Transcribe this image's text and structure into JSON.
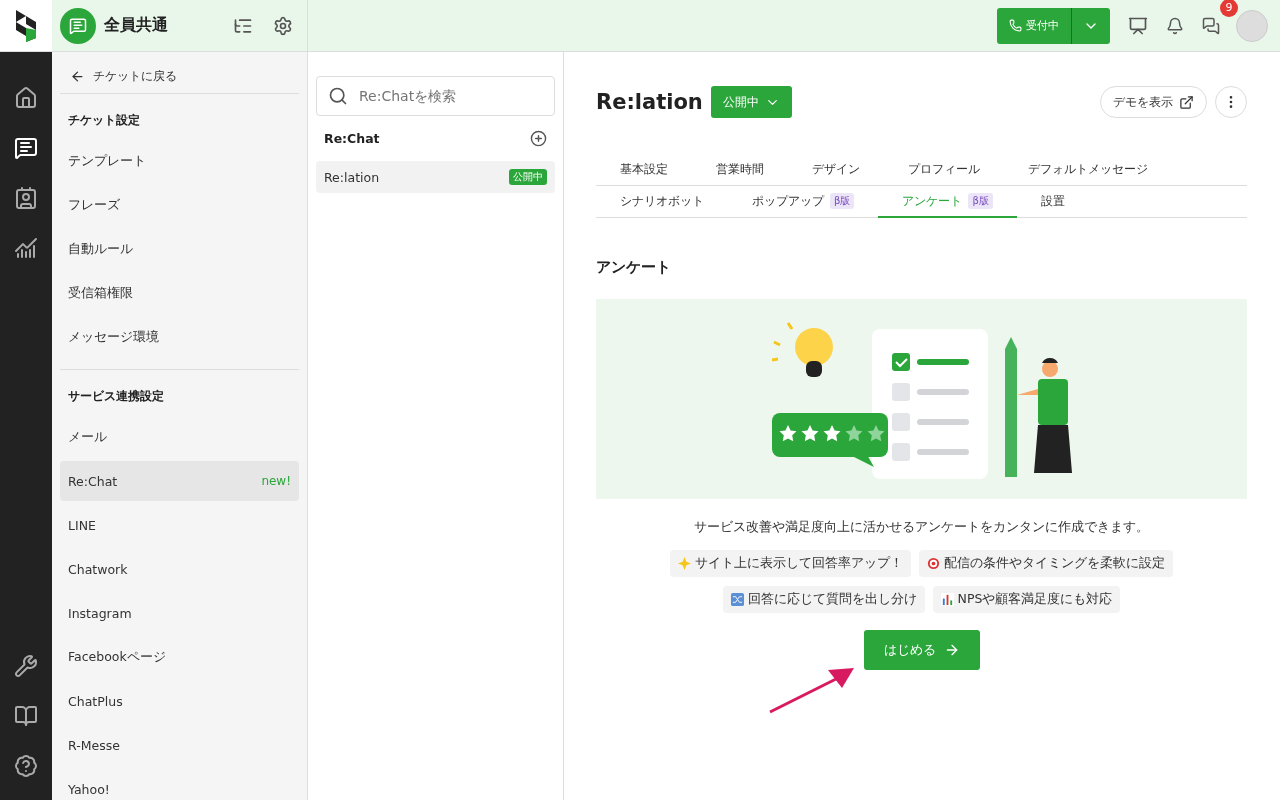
{
  "app_bar": {
    "workspace": "全員共通",
    "status_button": "受付中",
    "notification_count": "9"
  },
  "rail": [
    {
      "kind": "home",
      "selected": false
    },
    {
      "kind": "ticket",
      "selected": true
    },
    {
      "kind": "contacts",
      "selected": false
    },
    {
      "kind": "analytics",
      "selected": false
    }
  ],
  "rail_bottom": [
    {
      "kind": "tools",
      "selected": false
    },
    {
      "kind": "book",
      "selected": false
    },
    {
      "kind": "help",
      "selected": false
    }
  ],
  "sidebar": {
    "back_link": "チケットに戻る",
    "sections": [
      {
        "title": "チケット設定",
        "items": [
          {
            "label": "テンプレート",
            "selected": false
          },
          {
            "label": "フレーズ",
            "selected": false
          },
          {
            "label": "自動ルール",
            "selected": false
          },
          {
            "label": "受信箱権限",
            "selected": false
          },
          {
            "label": "メッセージ環境",
            "selected": false
          }
        ]
      },
      {
        "title": "サービス連携設定",
        "items": [
          {
            "label": "メール",
            "selected": false
          },
          {
            "label": "Re:Chat",
            "selected": true,
            "badge": "new!"
          },
          {
            "label": "LINE",
            "selected": false
          },
          {
            "label": "Chatwork",
            "selected": false
          },
          {
            "label": "Instagram",
            "selected": false
          },
          {
            "label": "Facebookページ",
            "selected": false
          },
          {
            "label": "ChatPlus",
            "selected": false
          },
          {
            "label": "R-Messe",
            "selected": false
          },
          {
            "label": "Yahoo!",
            "selected": false
          }
        ]
      }
    ]
  },
  "channel_list": {
    "search_placeholder": "Re:Chatを検索",
    "group_title": "Re:Chat",
    "items": [
      {
        "label": "Re:lation",
        "status": "公開中",
        "selected": true
      }
    ]
  },
  "main": {
    "title": "Re:lation",
    "status_button": "公開中",
    "demo_button": "デモを表示",
    "tab_rows": [
      [
        {
          "label": "基本設定",
          "selected": false
        },
        {
          "label": "営業時間",
          "selected": false
        },
        {
          "label": "デザイン",
          "selected": false
        },
        {
          "label": "プロフィール",
          "selected": false
        },
        {
          "label": "デフォルトメッセージ",
          "selected": false
        }
      ],
      [
        {
          "label": "シナリオボット",
          "selected": false
        },
        {
          "label": "ポップアップ",
          "badge": "β版",
          "selected": false
        },
        {
          "label": "アンケート",
          "badge": "β版",
          "selected": true
        },
        {
          "label": "設置",
          "selected": false
        }
      ]
    ],
    "section_title": "アンケート",
    "description": "サービス改善や満足度向上に活かせるアンケートをカンタンに作成できます。",
    "features": [
      [
        {
          "kind": "star",
          "label": "サイト上に表示して回答率アップ！"
        },
        {
          "kind": "target",
          "label": "配信の条件やタイミングを柔軟に設定"
        }
      ],
      [
        {
          "kind": "shuffle",
          "label": "回答に応じて質問を出し分け"
        },
        {
          "kind": "chart",
          "label": "NPSや顧客満足度にも対応"
        }
      ]
    ],
    "start_button": "はじめる"
  }
}
